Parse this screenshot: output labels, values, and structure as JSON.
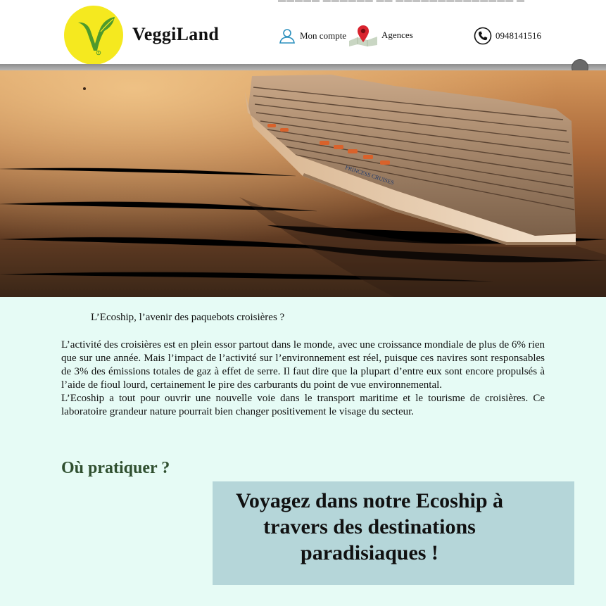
{
  "header": {
    "brand": "VeggiLand",
    "account_label": "Mon compte",
    "agences_label": "Agences",
    "phone_number": "0948141516"
  },
  "hero": {
    "ship_name": "PRINCESS CRUISES"
  },
  "article": {
    "title": "L’Ecoship, l’avenir des paquebots croisières ?",
    "paragraph_1": "L’activité des croisières est en plein essor partout dans le monde, avec une croissance mondiale de plus de 6% rien que sur une année. Mais l’impact de l’activité sur l’environnement est réel, puisque ces navires sont responsables de 3% des émissions totales de gaz à effet de serre. Il faut dire que la plupart d’entre eux sont encore propulsés à l’aide de fioul lourd, certainement le pire des carburants du point de vue environnemental.",
    "paragraph_2": "L’Ecoship a tout pour ouvrir une nouvelle voie dans le transport maritime et le tourisme de croisières. Ce laboratoire grandeur nature pourrait bien changer positivement le visage du secteur."
  },
  "section": {
    "heading": "Où pratiquer ?",
    "promo_text": "Voyagez dans notre Ecoship à travers des destinations paradisiaques !"
  },
  "colors": {
    "page_background": "#e6fbf5",
    "logo_yellow": "#f5e91f",
    "logo_green": "#4e9a2c",
    "heading_green": "#2f4f2f",
    "promo_background": "#b5d6d9",
    "pin_red": "#d9232e"
  },
  "icons": {
    "logo": "veggie-v-leaf-logo",
    "account": "user-icon",
    "agences": "map-pin-icon",
    "phone": "phone-icon"
  }
}
